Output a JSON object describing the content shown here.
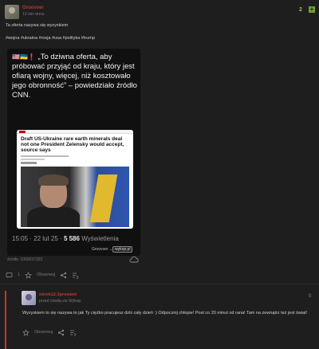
{
  "post": {
    "author": "Groovver",
    "time": "13 min temu",
    "votes": "2",
    "plus_label": "+",
    "text": "Ta oferta nazywa się wyzyskiem",
    "tags": "#wojna #ukraina #rosja #usa #polityka #trump",
    "media": {
      "flags": "🇺🇸🇺🇦❗",
      "quote": "„To dziwna oferta, aby próbować przyjąć od kraju, który jest ofiarą wojny, więcej, niż kosztowało jego obronność” – powiedziało źródło CNN.",
      "cnn_headline": "Draft US-Ukraine rare earth minerals deal not one President Zelensky would accept, source says",
      "stats_time": "15:05 · 22 lut 25 · ",
      "stats_views": "5 586",
      "stats_views_label": " Wyświetlenia",
      "credit": "Groovver ⌄",
      "wykop_mark": "wykop.pl"
    },
    "source": "źródło: 1000037323",
    "actions": {
      "comments_count": "1",
      "favorite_label": "Obserwuj",
      "share_label": "",
      "more_label": ""
    }
  },
  "comment": {
    "author": "mirek12-2prowent",
    "time": "przed chwilą  via Wykop",
    "votes": "0",
    "text": "Wyzyskiem to się nazywa to jak Ty ciężko pracujesz dziś cały dzień :) Odpocznij chłopie! Post co 20 minut od rana! Tam na zewnątrz też jest świat!",
    "favorite_label": "Obserwuj"
  },
  "colors": {
    "accent_red": "#c0392b",
    "vote_green": "#9bc53d",
    "plus_green": "#6fa030"
  }
}
